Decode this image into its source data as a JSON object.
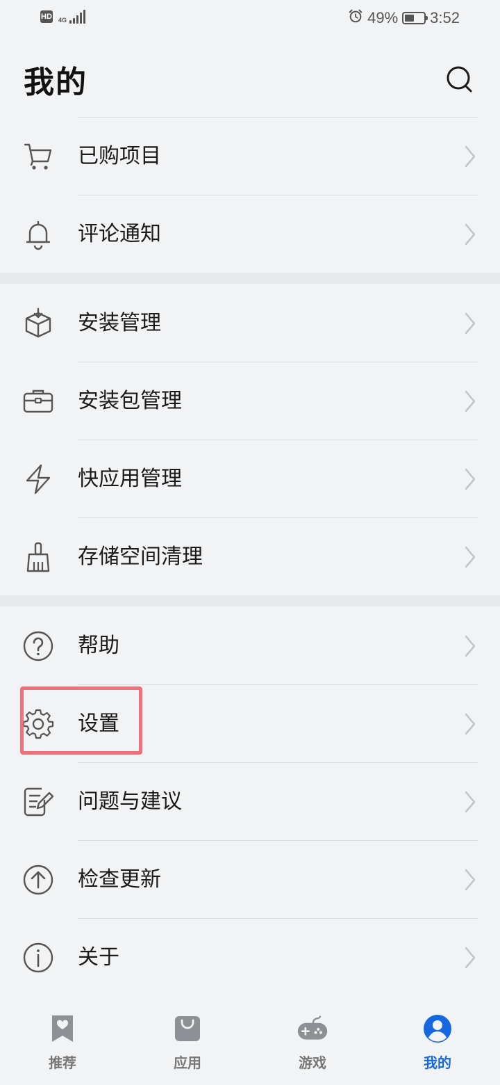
{
  "status_bar": {
    "hd_label": "HD",
    "network_type": "4G",
    "signal_bars": 5,
    "battery_percent": "49%",
    "battery_level": 0.49,
    "time": "3:52",
    "alarm_icon": "alarm-icon"
  },
  "header": {
    "title": "我的",
    "search_icon": "search-icon"
  },
  "menu": {
    "purchased": {
      "label": "已购项目",
      "icon": "cart-icon"
    },
    "comments": {
      "label": "评论通知",
      "icon": "bell-icon"
    },
    "install_manage": {
      "label": "安装管理",
      "icon": "box-download-icon"
    },
    "package_manage": {
      "label": "安装包管理",
      "icon": "briefcase-icon"
    },
    "quick_app_manage": {
      "label": "快应用管理",
      "icon": "lightning-icon"
    },
    "storage_clean": {
      "label": "存储空间清理",
      "icon": "broom-icon"
    },
    "help": {
      "label": "帮助",
      "icon": "question-icon"
    },
    "settings": {
      "label": "设置",
      "icon": "gear-icon"
    },
    "feedback": {
      "label": "问题与建议",
      "icon": "edit-note-icon"
    },
    "check_update": {
      "label": "检查更新",
      "icon": "arrow-up-circle-icon"
    },
    "about": {
      "label": "关于",
      "icon": "info-icon"
    }
  },
  "bottom_nav": {
    "recommend": {
      "label": "推荐",
      "icon": "bookmark-heart-icon"
    },
    "apps": {
      "label": "应用",
      "icon": "shopping-bag-icon"
    },
    "games": {
      "label": "游戏",
      "icon": "gamepad-icon"
    },
    "mine": {
      "label": "我的",
      "icon": "user-avatar-icon"
    },
    "active_tab": "我的",
    "active_color": "#1668e0"
  },
  "colors": {
    "background": "#f1f3f5",
    "highlight_border": "#ef7179",
    "accent": "#1668e0"
  }
}
